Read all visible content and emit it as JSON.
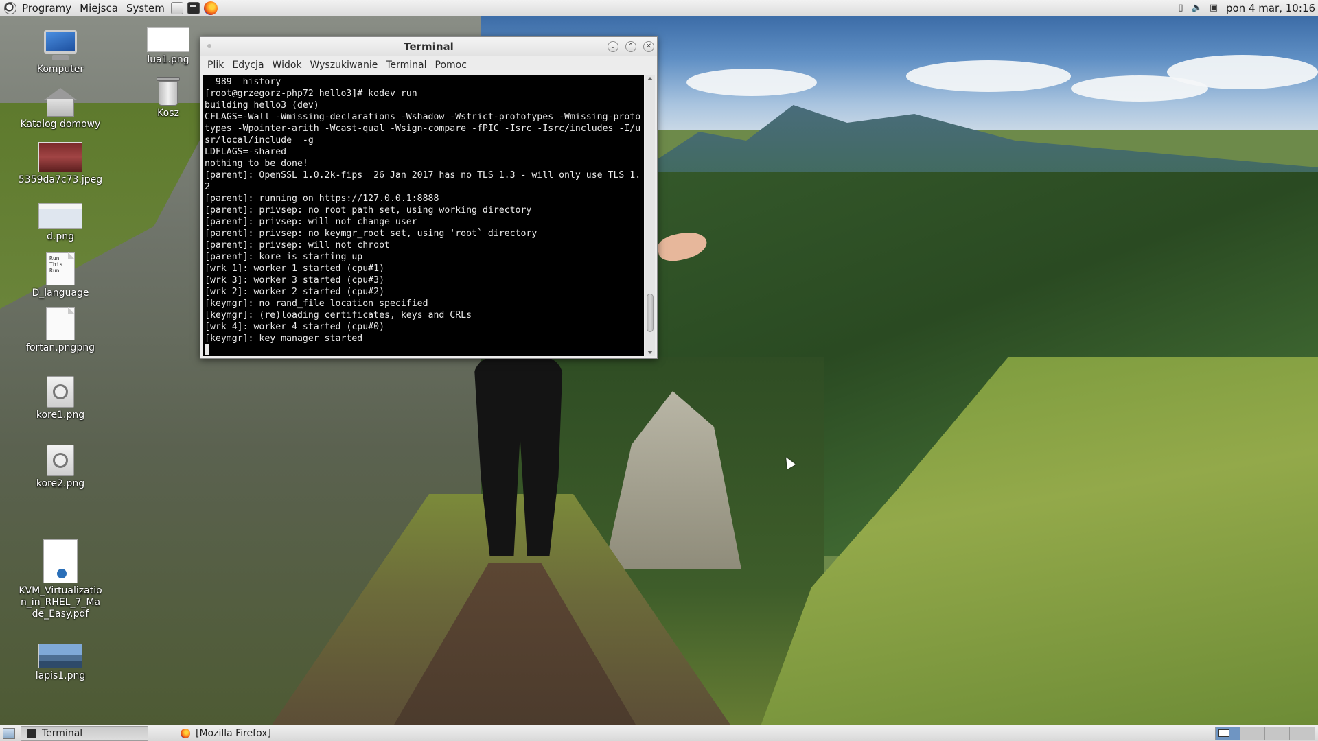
{
  "top_panel": {
    "menus": [
      "Programy",
      "Miejsca",
      "System"
    ],
    "launchers": [
      "files-icon",
      "terminal-icon",
      "firefox-icon"
    ],
    "tray_icons": [
      "battery-icon",
      "volume-icon",
      "network-icon"
    ],
    "clock": "pon  4 mar, 10:16"
  },
  "desktop": {
    "icons": [
      {
        "label": "Komputer",
        "icon": "computer-icon"
      },
      {
        "label": "Katalog domowy",
        "icon": "home-folder-icon"
      },
      {
        "label": "5359da7c73.jpeg",
        "icon": "image-icon"
      },
      {
        "label": "d.png",
        "icon": "image-icon"
      },
      {
        "label": "D_language",
        "icon": "text-file-icon",
        "preview": "Run\nThis\nRun"
      },
      {
        "label": "fortan.pngpng",
        "icon": "text-file-icon"
      },
      {
        "label": "kore1.png",
        "icon": "media-file-icon"
      },
      {
        "label": "kore2.png",
        "icon": "media-file-icon"
      },
      {
        "label": "KVM_Virtualization_in_RHEL_7_Made_Easy.pdf",
        "icon": "pdf-icon"
      },
      {
        "label": "lapis1.png",
        "icon": "image-icon"
      },
      {
        "label": "lua1.png",
        "icon": "image-icon"
      },
      {
        "label": "Kosz",
        "icon": "trash-icon"
      }
    ]
  },
  "terminal": {
    "title": "Terminal",
    "menu": [
      "Plik",
      "Edycja",
      "Widok",
      "Wyszukiwanie",
      "Terminal",
      "Pomoc"
    ],
    "lines": [
      "  989  history",
      "[root@grzegorz-php72 hello3]# kodev run",
      "building hello3 (dev)",
      "CFLAGS=-Wall -Wmissing-declarations -Wshadow -Wstrict-prototypes -Wmissing-prototypes -Wpointer-arith -Wcast-qual -Wsign-compare -fPIC -Isrc -Isrc/includes -I/usr/local/include  -g",
      "LDFLAGS=-shared",
      "nothing to be done!",
      "[parent]: OpenSSL 1.0.2k-fips  26 Jan 2017 has no TLS 1.3 - will only use TLS 1.2",
      "[parent]: running on https://127.0.0.1:8888",
      "[parent]: privsep: no root path set, using working directory",
      "[parent]: privsep: will not change user",
      "[parent]: privsep: no keymgr_root set, using 'root` directory",
      "[parent]: privsep: will not chroot",
      "[parent]: kore is starting up",
      "[wrk 1]: worker 1 started (cpu#1)",
      "[wrk 3]: worker 3 started (cpu#3)",
      "[wrk 2]: worker 2 started (cpu#2)",
      "[keymgr]: no rand_file location specified",
      "[keymgr]: (re)loading certificates, keys and CRLs",
      "[wrk 4]: worker 4 started (cpu#0)",
      "[keymgr]: key manager started"
    ],
    "scroll_position": 0.93
  },
  "bottom_panel": {
    "tasks": [
      {
        "label": "Terminal",
        "icon": "terminal-icon",
        "active": true
      },
      {
        "label": "[Mozilla Firefox]",
        "icon": "firefox-icon",
        "active": false
      }
    ],
    "workspaces": 4,
    "active_workspace": 1
  }
}
